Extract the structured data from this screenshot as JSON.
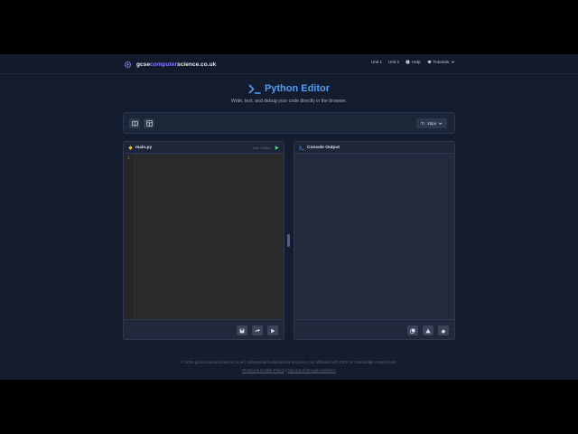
{
  "brand": {
    "prefix": "gcse",
    "accent": "computer",
    "suffix": "science.co.uk"
  },
  "nav": [
    {
      "label": "Unit 1"
    },
    {
      "label": "Unit 2"
    },
    {
      "label": "Help",
      "icon": "help-circle-icon"
    },
    {
      "label": "Tutorials",
      "icon": "graduation-cap-icon"
    }
  ],
  "page": {
    "title": "Python Editor",
    "subtitle": "Write, test, and debug your code directly in the browser."
  },
  "toolbar": {
    "left_buttons": [
      {
        "icon": "book-icon"
      },
      {
        "icon": "layout-icon"
      }
    ],
    "font_size_label": "16px",
    "font_icon": "T↕"
  },
  "editor": {
    "filename": "main.py",
    "shortcut": "Ctrl + Enter",
    "line_numbers": [
      "1"
    ],
    "code": ""
  },
  "console": {
    "title": "Console Output",
    "output": ""
  },
  "footer": {
    "copyright": "© 2026 gcsecomputerscience.co.uk | Independent educational resource, not affiliated with OCR or Cambridge Assessment.",
    "privacy_link": "Privacy & Cookie Policy",
    "separator": "|",
    "optout_link": "Opt-out of Google Analytics"
  },
  "colors": {
    "background": "#141d30",
    "accent_blue": "#4f9cf9",
    "accent_purple": "#8b7cf6",
    "run_green": "#4ade80"
  }
}
